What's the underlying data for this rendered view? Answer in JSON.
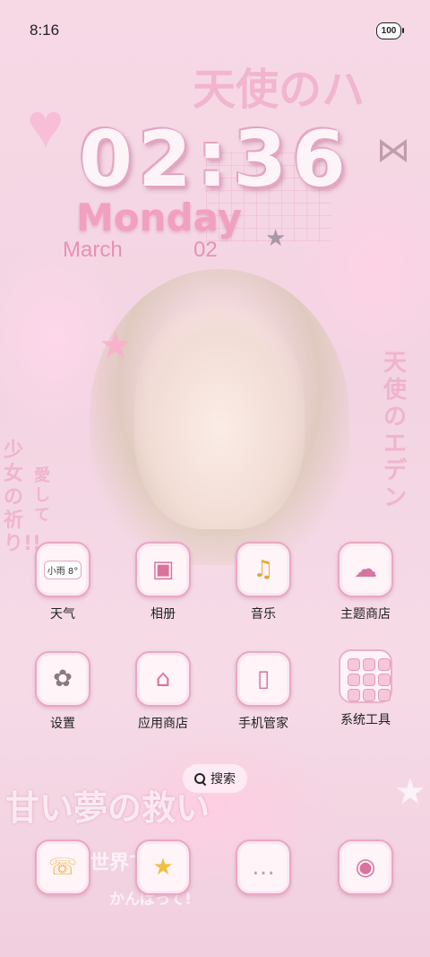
{
  "status_bar": {
    "time": "8:16",
    "battery": "100"
  },
  "clock": {
    "time": "02:36",
    "day": "Monday",
    "month": "March",
    "date": "02"
  },
  "apps": [
    {
      "label": "天气",
      "icon": "weather-icon",
      "badge": "小雨 8°"
    },
    {
      "label": "相册",
      "icon": "gallery-icon"
    },
    {
      "label": "音乐",
      "icon": "music-icon"
    },
    {
      "label": "主题商店",
      "icon": "theme-store-icon"
    },
    {
      "label": "设置",
      "icon": "settings-icon"
    },
    {
      "label": "应用商店",
      "icon": "app-store-icon"
    },
    {
      "label": "手机管家",
      "icon": "phone-manager-icon"
    },
    {
      "label": "系统工具",
      "icon": "system-tools-folder"
    }
  ],
  "search": {
    "label": "搜索"
  },
  "dock": [
    {
      "icon": "phone-icon"
    },
    {
      "icon": "contacts-icon"
    },
    {
      "icon": "messages-icon"
    },
    {
      "icon": "camera-icon"
    }
  ],
  "wallpaper_text": {
    "top": "天使のハ",
    "side_right": "天使のエデン",
    "side_left": "少女の祈り!!",
    "love": "愛して",
    "bottom": "甘い夢の救い",
    "bottom2": "世界で",
    "bottom3": "かんばって!"
  },
  "colors": {
    "accent": "#e9a7c3",
    "clock": "#fdf4f8",
    "day": "#f2a0c0"
  }
}
